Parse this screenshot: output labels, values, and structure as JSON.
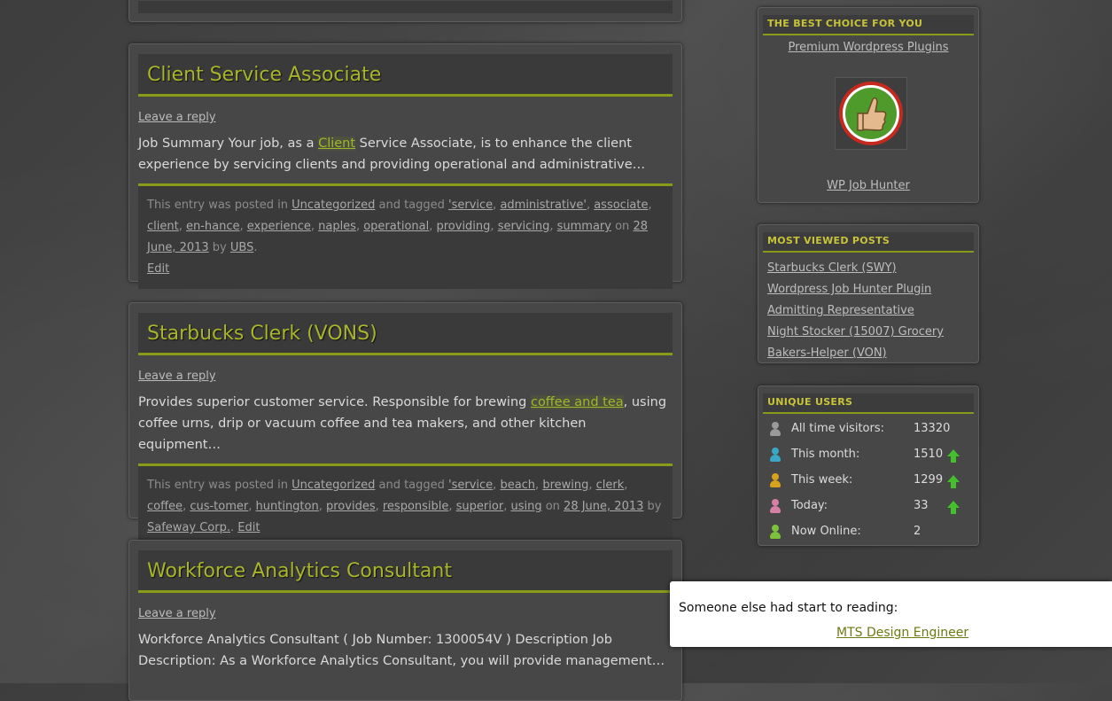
{
  "posts": [
    {
      "title": "Client Service Associate",
      "reply": "Leave a reply",
      "excerpt_pre": "Job Summary Your job, as a ",
      "excerpt_link": "Client",
      "excerpt_post": " Service Associate, is to enhance the client experience by servicing clients and providing operational and administrative…",
      "meta_posted": "This entry was posted in ",
      "category": "Uncategorized",
      "meta_tagged": " and tagged ",
      "tags": [
        "'service",
        "administrative'",
        "associate",
        "client",
        "en-hance",
        "experience",
        "naples",
        "operational",
        "providing",
        "servicing",
        "summary"
      ],
      "meta_on": " on ",
      "date": "28 June, 2013",
      "meta_by": " by ",
      "author": "UBS",
      "edit": "Edit"
    },
    {
      "title": "Starbucks Clerk (VONS)",
      "reply": "Leave a reply",
      "excerpt_pre": "Provides superior customer service. Responsible for brewing ",
      "excerpt_link": "coffee and tea",
      "excerpt_post": ", using coffee urns, drip or vacuum coffee and tea makers, and other kitchen equipment…",
      "meta_posted": "This entry was posted in ",
      "category": "Uncategorized",
      "meta_tagged": " and tagged ",
      "tags": [
        "'service",
        "beach",
        "brewing",
        "clerk",
        "coffee",
        "cus-tomer",
        "huntington",
        "provides",
        "responsible",
        "superior",
        "using"
      ],
      "meta_on": " on ",
      "date": "28 June, 2013",
      "meta_by": " by ",
      "author": "Safeway Corp.",
      "edit": "Edit"
    },
    {
      "title": "Workforce Analytics Consultant",
      "reply": "Leave a reply",
      "excerpt": "Workforce Analytics Consultant ( Job Number: 1300054V ) Description Job Description: As a Workforce Analytics Consultant, you will provide management…"
    }
  ],
  "sidebar": {
    "best_choice": {
      "title": "THE BEST CHOICE FOR YOU",
      "link_top": "Premium Wordpress Plugins",
      "link_bottom": "WP Job Hunter",
      "thumb_icon": "thumbs-up-icon"
    },
    "most_viewed": {
      "title": "MOST VIEWED POSTS",
      "items": [
        "Starbucks Clerk (SWY)",
        "Wordpress Job Hunter Plugin",
        "Admitting Representative",
        "Night Stocker (15007) Grocery",
        "Bakers-Helper (VON)"
      ]
    },
    "unique_users": {
      "title": "UNIQUE USERS",
      "rows": [
        {
          "label": "All time visitors:",
          "value": "13320",
          "color": "#9a9a9a",
          "trend": false
        },
        {
          "label": "This month:",
          "value": "1510",
          "color": "#3aa6c8",
          "trend": true
        },
        {
          "label": "This week:",
          "value": "1299",
          "color": "#d9a21b",
          "trend": true
        },
        {
          "label": "Today:",
          "value": "33",
          "color": "#d77fa5",
          "trend": true
        },
        {
          "label": "Now Online:",
          "value": "2",
          "color": "#7cc23a",
          "trend": false
        }
      ]
    }
  },
  "toast": {
    "text": "Someone else had start to reading:",
    "link": "MTS Design Engineer"
  },
  "colors": {
    "accent": "#8a9a19",
    "title": "#a8b52a",
    "trend_up": "#43c02b"
  }
}
